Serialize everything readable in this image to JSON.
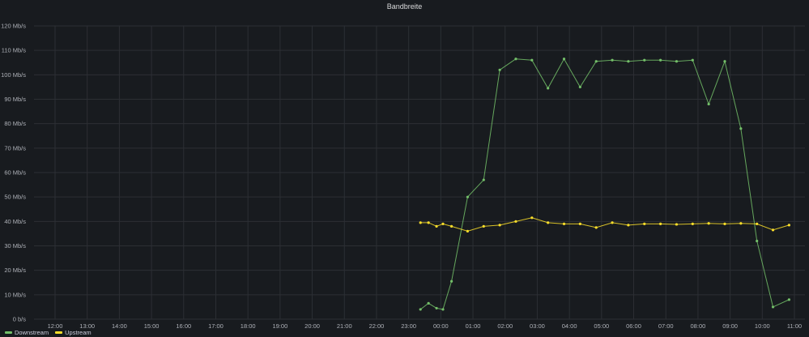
{
  "chart_data": {
    "type": "line",
    "title": "Bandbreite",
    "xlabel": "",
    "ylabel": "",
    "unit": "Mb/s",
    "ylim": [
      0,
      120
    ],
    "y_ticks": [
      "0 b/s",
      "10 Mb/s",
      "20 Mb/s",
      "30 Mb/s",
      "40 Mb/s",
      "50 Mb/s",
      "60 Mb/s",
      "70 Mb/s",
      "80 Mb/s",
      "90 Mb/s",
      "100 Mb/s",
      "110 Mb/s",
      "120 Mb/s"
    ],
    "x_ticks": [
      "12:00",
      "13:00",
      "14:00",
      "15:00",
      "16:00",
      "17:00",
      "18:00",
      "19:00",
      "20:00",
      "21:00",
      "22:00",
      "23:00",
      "00:00",
      "01:00",
      "02:00",
      "03:00",
      "04:00",
      "05:00",
      "06:00",
      "07:00",
      "08:00",
      "09:00",
      "10:00",
      "11:00"
    ],
    "x": [
      "23:22",
      "23:37",
      "23:52",
      "00:04",
      "00:20",
      "00:50",
      "01:20",
      "01:50",
      "02:20",
      "02:50",
      "03:20",
      "03:50",
      "04:20",
      "04:50",
      "05:20",
      "05:50",
      "06:20",
      "06:50",
      "07:20",
      "07:50",
      "08:20",
      "08:50",
      "09:20",
      "09:50",
      "10:20",
      "10:50"
    ],
    "grid": true,
    "legend_position": "bottom-left",
    "series": [
      {
        "name": "Downstream",
        "color": "#73bf69",
        "values": [
          4,
          6.5,
          4.5,
          4,
          15.5,
          50,
          57,
          102,
          106.5,
          106,
          94.5,
          106.5,
          95,
          105.5,
          106,
          105.5,
          106,
          106,
          105.5,
          106,
          88,
          105.5,
          78,
          32,
          5,
          8
        ]
      },
      {
        "name": "Upstream",
        "color": "#fade2a",
        "values": [
          39.5,
          39.5,
          38,
          39,
          38,
          36,
          38,
          38.5,
          40,
          41.5,
          39.5,
          39,
          39,
          37.5,
          39.5,
          38.5,
          39,
          39,
          38.8,
          39,
          39.2,
          39,
          39.2,
          39,
          36.5,
          38.5
        ]
      }
    ]
  }
}
